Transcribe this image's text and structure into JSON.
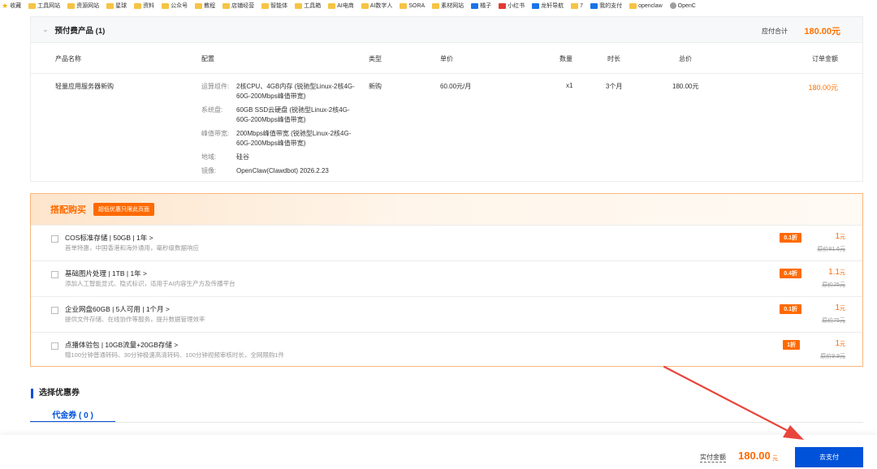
{
  "bookmarks": [
    {
      "label": "收藏",
      "icon": "star-icon"
    },
    {
      "label": "工具网站",
      "icon": "folder-icon"
    },
    {
      "label": "资源网站",
      "icon": "folder-icon"
    },
    {
      "label": "星球",
      "icon": "folder-icon"
    },
    {
      "label": "资料",
      "icon": "folder-icon"
    },
    {
      "label": "公众号",
      "icon": "folder-icon"
    },
    {
      "label": "教程",
      "icon": "folder-icon"
    },
    {
      "label": "店铺经营",
      "icon": "folder-icon"
    },
    {
      "label": "智能体",
      "icon": "folder-icon"
    },
    {
      "label": "工具箱",
      "icon": "folder-icon"
    },
    {
      "label": "AI电商",
      "icon": "folder-icon"
    },
    {
      "label": "AI数字人",
      "icon": "folder-icon"
    },
    {
      "label": "SORA",
      "icon": "folder-icon"
    },
    {
      "label": "素材网站",
      "icon": "folder-icon"
    },
    {
      "label": "橘子",
      "icon": "site-icon"
    },
    {
      "label": "小红书",
      "icon": "xiaohongshu-icon"
    },
    {
      "label": "龙轩导航",
      "icon": "site-icon"
    },
    {
      "label": "7",
      "icon": "folder-icon"
    },
    {
      "label": "我的支付",
      "icon": "site-icon"
    },
    {
      "label": "openclaw",
      "icon": "folder-icon"
    },
    {
      "label": "OpenC",
      "icon": "globe-icon"
    }
  ],
  "product": {
    "section_title": "预付费产品 (1)",
    "total_label": "应付合计",
    "total_value": "180.00元",
    "columns": [
      "产品名称",
      "配置",
      "类型",
      "单价",
      "数量",
      "时长",
      "总价",
      "订单金额"
    ],
    "row": {
      "name": "轻量应用服务器新购",
      "config": [
        {
          "k": "运算组件:",
          "v": "2核CPU、4GB内存 (锐驰型Linux-2核4G-60G-200Mbps峰值带宽)"
        },
        {
          "k": "系统盘:",
          "v": "60GB SSD云硬盘 (锐驰型Linux-2核4G-60G-200Mbps峰值带宽)"
        },
        {
          "k": "峰值带宽:",
          "v": "200Mbps峰值带宽 (锐驰型Linux-2核4G-60G-200Mbps峰值带宽)"
        },
        {
          "k": "地域:",
          "v": "硅谷"
        },
        {
          "k": "镜像:",
          "v": "OpenClaw(Clawdbot) 2026.2.23"
        }
      ],
      "type": "新购",
      "unit_price": "60.00元/月",
      "qty": "x1",
      "duration": "3个月",
      "total": "180.00元",
      "order_amount": "180.00元"
    }
  },
  "addons": {
    "title": "搭配购买",
    "tag": "超低优惠只限此页面",
    "items": [
      {
        "name": "COS标准存储 | 50GB | 1年 >",
        "desc": "首单特惠，中国香港和海外通用，毫秒级数据响应",
        "discount": "0.1折",
        "price": "1",
        "unit": "元",
        "orig": "原价81.6元"
      },
      {
        "name": "基础图片处理 | 1TB | 1年 >",
        "desc": "添加人工智能显式、隐式标识，适用于AI内容生产方及传播平台",
        "discount": "0.4折",
        "price": "1.1",
        "unit": "元",
        "orig": "原价25元"
      },
      {
        "name": "企业网盘60GB | 5人可用 | 1个月 >",
        "desc": "提供文件存储、在线协作等服务，提升数据管理效率",
        "discount": "0.1折",
        "price": "1",
        "unit": "元",
        "orig": "原价75元"
      },
      {
        "name": "点播体验包 | 10GB流量+20GB存储 >",
        "desc": "赠100分钟普通转码、30分钟极速高清转码、100分钟视频审核时长，全网限购1件",
        "discount": "1折",
        "price": "1",
        "unit": "元",
        "orig": "原价9.9元"
      }
    ]
  },
  "coupon": {
    "title": "选择优惠券",
    "tab": "代金券 ( 0 )"
  },
  "footer": {
    "paid_label": "实付金额",
    "paid_value": "180.00",
    "paid_unit": "元",
    "pay_button": "去支付"
  },
  "colors": {
    "accent_orange": "#ff6a00",
    "primary_blue": "#0052d9",
    "annotation_red": "#e8453c"
  }
}
